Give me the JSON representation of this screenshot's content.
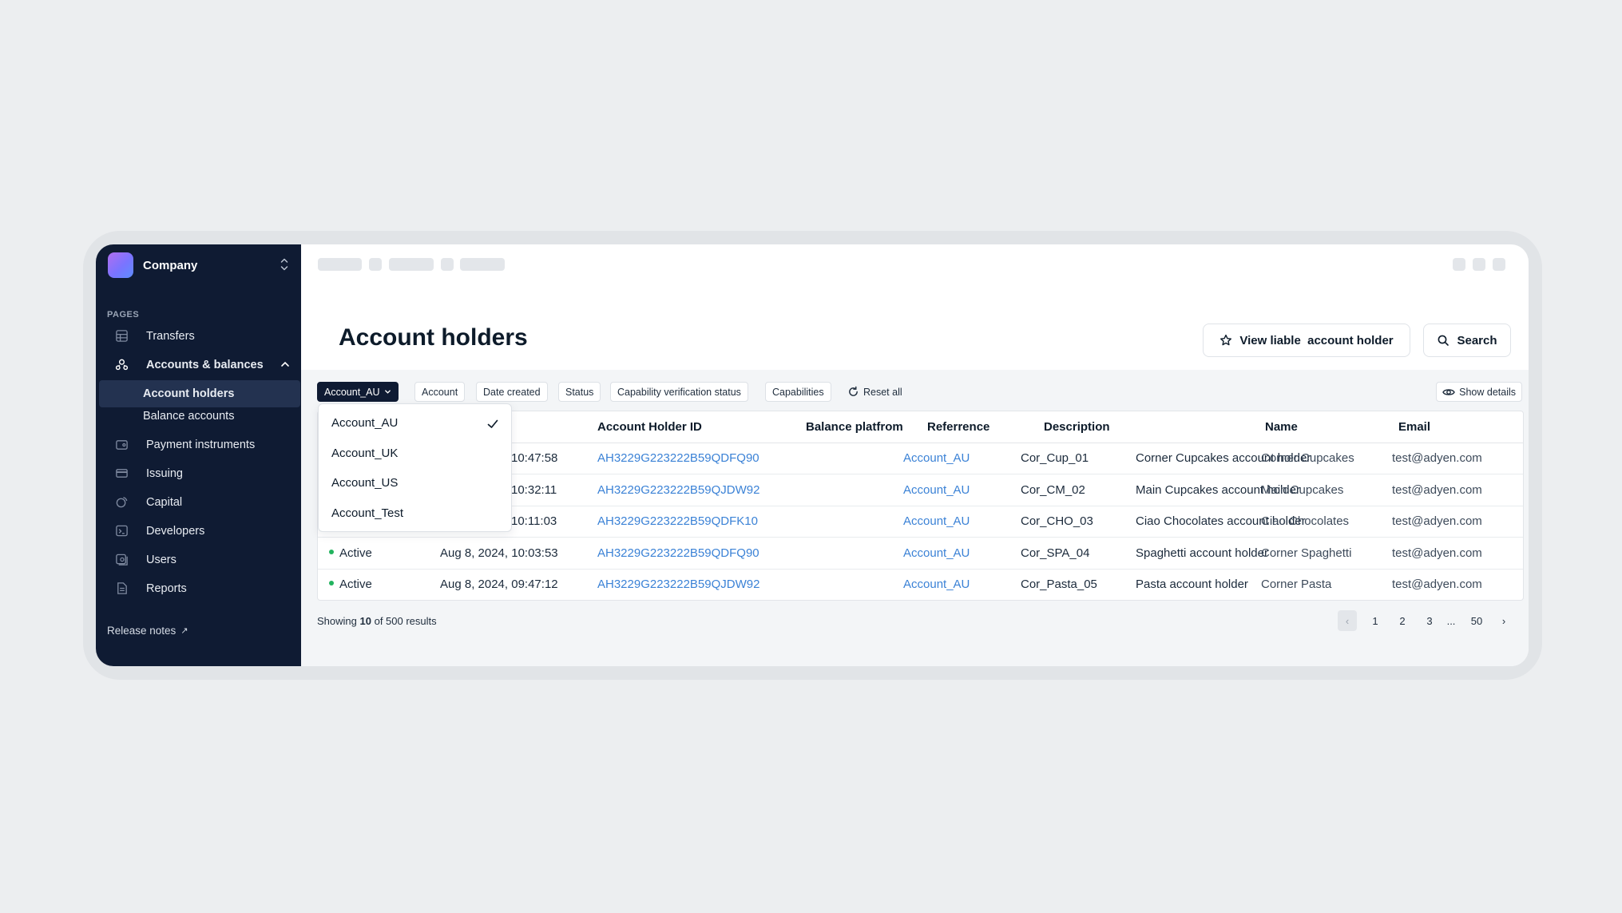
{
  "company": {
    "name": "Company"
  },
  "sidebar": {
    "section_label": "PAGES",
    "items": [
      {
        "label": "Transfers",
        "icon": "table-icon"
      },
      {
        "label": "Accounts & balances",
        "icon": "users-icon"
      },
      {
        "label": "Account holders"
      },
      {
        "label": "Balance accounts"
      },
      {
        "label": "Payment instruments",
        "icon": "wallet-icon"
      },
      {
        "label": "Issuing",
        "icon": "card-icon"
      },
      {
        "label": "Capital",
        "icon": "capital-icon"
      },
      {
        "label": "Developers",
        "icon": "terminal-icon"
      },
      {
        "label": "Users",
        "icon": "users-box-icon"
      },
      {
        "label": "Reports",
        "icon": "report-icon"
      }
    ],
    "release_notes": "Release notes",
    "release_notes_arrow": "↗"
  },
  "page": {
    "title": "Account holders",
    "view_liable_label": "View liable  account holder",
    "search_label": "Search"
  },
  "filters": {
    "account_selected": "Account_AU",
    "chips": [
      "Account",
      "Date created",
      "Status",
      "Capability verification status",
      "Capabilities"
    ],
    "reset_label": "Reset all",
    "show_details_label": "Show details"
  },
  "dropdown": {
    "options": [
      "Account_AU",
      "Account_UK",
      "Account_US",
      "Account_Test"
    ],
    "selected": "Account_AU"
  },
  "table": {
    "columns": [
      "Account Holder ID",
      "Balance platfrom",
      "Referrence",
      "Description",
      "Name",
      "Email"
    ],
    "rows": [
      {
        "status": "",
        "date": "10:47:58",
        "id": "AH3229G223222B59QDFQ90",
        "platform": "Account_AU",
        "reference": "Cor_Cup_01",
        "description": "Corner Cupcakes account holder",
        "name": "Corner Cupcakes",
        "email": "test@adyen.com"
      },
      {
        "status": "",
        "date": "10:32:11",
        "id": "AH3229G223222B59QJDW92",
        "platform": "Account_AU",
        "reference": "Cor_CM_02",
        "description": "Main Cupcakes account holder",
        "name": "Main Cupcakes",
        "email": "test@adyen.com"
      },
      {
        "status": "",
        "date": "10:11:03",
        "id": "AH3229G223222B59QDFK10",
        "platform": "Account_AU",
        "reference": "Cor_CHO_03",
        "description": "Ciao Chocolates account holder",
        "name": "Ciao Chocolates",
        "email": "test@adyen.com"
      },
      {
        "status": "Active",
        "date": "Aug 8, 2024, 10:03:53",
        "id": "AH3229G223222B59QDFQ90",
        "platform": "Account_AU",
        "reference": "Cor_SPA_04",
        "description": "Spaghetti account holder",
        "name": "Corner Spaghetti",
        "email": "test@adyen.com"
      },
      {
        "status": "Active",
        "date": "Aug 8, 2024, 09:47:12",
        "id": "AH3229G223222B59QJDW92",
        "platform": "Account_AU",
        "reference": "Cor_Pasta_05",
        "description": "Pasta account holder",
        "name": "Corner Pasta",
        "email": "test@adyen.com"
      }
    ]
  },
  "pagination": {
    "showing_prefix": "Showing",
    "showing_count": "10",
    "showing_suffix": "of 500 results",
    "prev": "‹",
    "pages": [
      "1",
      "2",
      "3",
      "...",
      "50"
    ],
    "next": "›"
  },
  "colors": {
    "sidebar_bg": "#0f1b33",
    "link": "#3b82d6",
    "active_status": "#22b35e"
  }
}
